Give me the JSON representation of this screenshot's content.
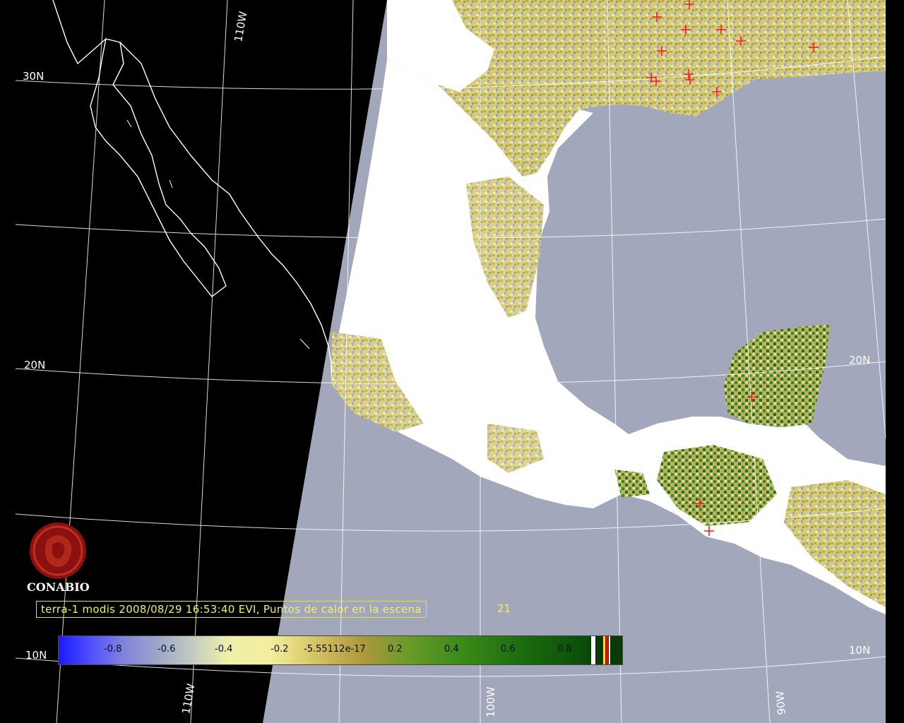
{
  "caption": {
    "text": "terra-1 modis 2008/08/29 16:53:40 EVI, Puntos de calor en la escena",
    "count": "21"
  },
  "logo": {
    "name": "CONABIO"
  },
  "grid_labels": {
    "lat_30n": "30N",
    "lat_20n_left": "20N",
    "lat_20n_right": "20N",
    "lat_10n_left": "10N",
    "lat_10n_right": "10N",
    "lon_110w_top": "110W",
    "lon_110w_bottom": "110W",
    "lon_100w": "100W",
    "lon_90w": "90W"
  },
  "colorbar": {
    "ticks": [
      "-0.8",
      "-0.6",
      "-0.4",
      "-0.2",
      "-5.55112e-17",
      "0.2",
      "0.4",
      "0.6",
      "0.8"
    ]
  },
  "colors": {
    "ocean": "#a3a7bc",
    "land_bare": "#ffffff",
    "vegetation_low": "#d9d27a",
    "vegetation_high": "#2e7a1a",
    "hotspot": "#ff1a1a",
    "grid": "#ffffff",
    "caption": "#f0f060"
  }
}
